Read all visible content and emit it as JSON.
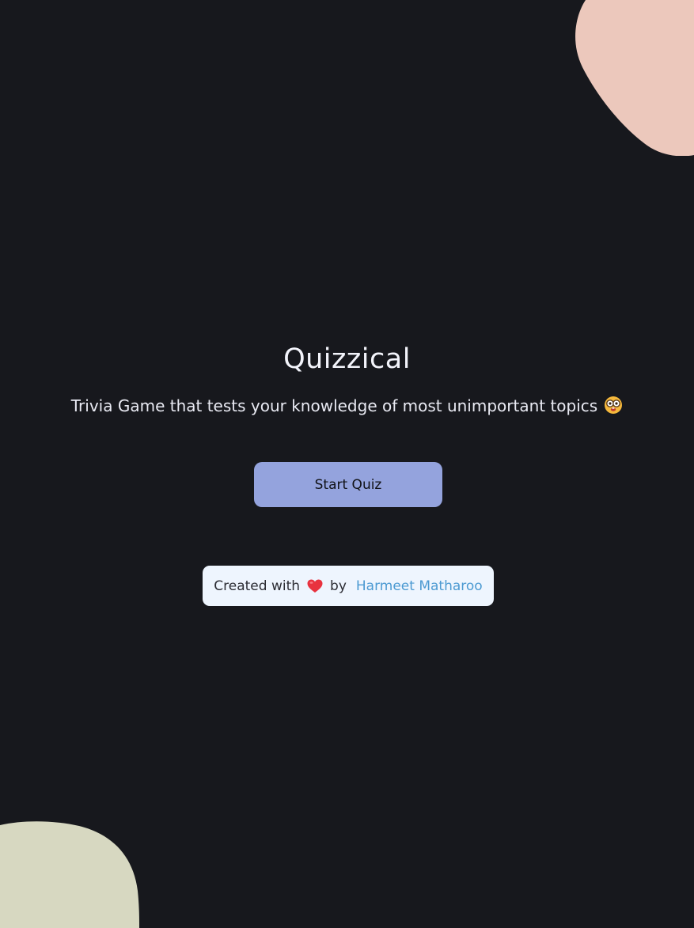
{
  "app": {
    "title": "Quizzical",
    "subtitle": "Trivia Game that tests your knowledge of most unimportant topics",
    "subtitle_icon": "nerd-face-emoji"
  },
  "actions": {
    "start_label": "Start Quiz"
  },
  "credit": {
    "prefix": "Created with",
    "icon": "red-heart-emoji",
    "by": "by",
    "author": "Harmeet Matharoo"
  },
  "colors": {
    "background": "#17181d",
    "blob_top": "#ecc8bc",
    "blob_bottom": "#d7d8c1",
    "button": "#94a3dd",
    "credit_background": "#eef5fe",
    "link": "#4c9ad2"
  }
}
